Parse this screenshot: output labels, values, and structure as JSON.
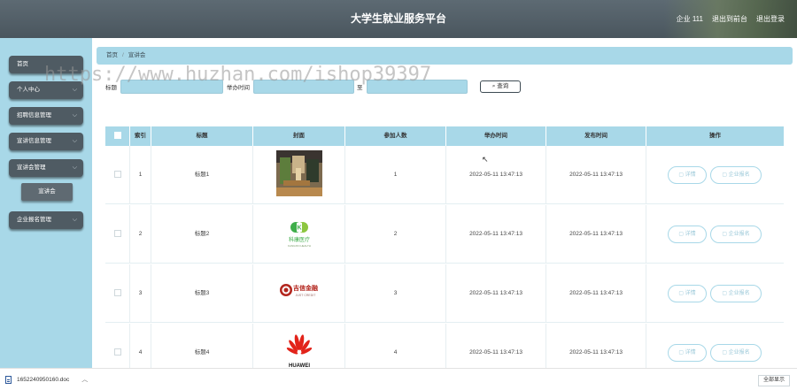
{
  "header": {
    "title": "大学生就业服务平台",
    "user": "企业 111",
    "back_to_frontend": "退出到前台",
    "logout": "退出登录"
  },
  "sidebar": {
    "items": [
      {
        "label": "首页"
      },
      {
        "label": "个人中心"
      },
      {
        "label": "招聘信息管理"
      },
      {
        "label": "宣讲信息管理"
      },
      {
        "label": "宣讲会管理"
      },
      {
        "label": "企业报名管理"
      }
    ],
    "sub_item": "宣讲会"
  },
  "breadcrumb": {
    "home": "首页",
    "current": "宣讲会"
  },
  "search": {
    "title_label": "标题",
    "time_label": "举办时间",
    "to_label": "至",
    "button": "查询"
  },
  "watermark": "https://www.huzhan.com/ishop39397",
  "table": {
    "headers": [
      "索引",
      "标题",
      "封面",
      "参加人数",
      "举办时间",
      "发布时间",
      "操作"
    ],
    "rows": [
      {
        "index": "1",
        "title": "标题1",
        "cover": "cafe-photo",
        "count": "1",
        "held": "2022-05-11 13:47:13",
        "published": "2022-05-11 13:47:13"
      },
      {
        "index": "2",
        "title": "标题2",
        "cover": "kangxin-logo",
        "count": "2",
        "held": "2022-05-11 13:47:13",
        "published": "2022-05-11 13:47:13"
      },
      {
        "index": "3",
        "title": "标题3",
        "cover": "jixin-finance-logo",
        "count": "3",
        "held": "2022-05-11 13:47:13",
        "published": "2022-05-11 13:47:13"
      },
      {
        "index": "4",
        "title": "标题4",
        "cover": "huawei-logo",
        "count": "4",
        "held": "2022-05-11 13:47:13",
        "published": "2022-05-11 13:47:13"
      }
    ],
    "action_detail": "详情",
    "action_signup": "企业报名"
  },
  "logos": {
    "kangxin_text": "科康医疗",
    "kangxin_sub": "KANGXIN HEALTH",
    "jixin_text": "吉信金融",
    "jixin_sub": "JUST CREDIT",
    "huawei_text": "HUAWEI"
  },
  "bottombar": {
    "filename": "1652240950160.doc",
    "show_all": "全部显示"
  },
  "colors": {
    "accent": "#a8d8e8",
    "header": "#4f5b63",
    "sidebar_btn": "#4f5b63"
  }
}
